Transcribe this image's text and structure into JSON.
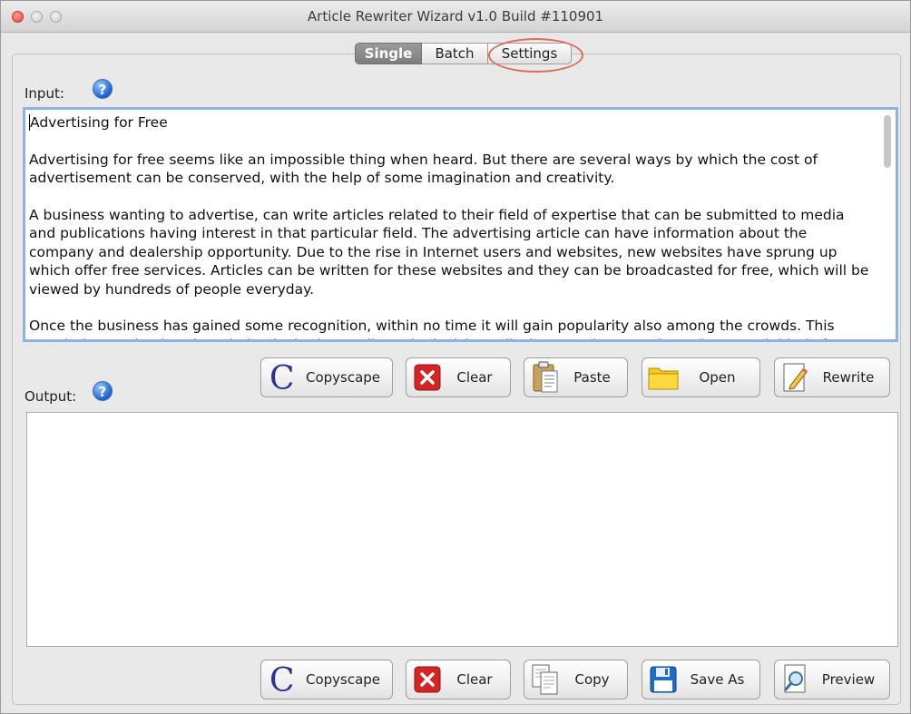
{
  "window": {
    "title": "Article Rewriter Wizard v1.0 Build #110901"
  },
  "tabs": [
    {
      "label": "Single",
      "active": true
    },
    {
      "label": "Batch",
      "active": false
    },
    {
      "label": "Settings",
      "active": false
    }
  ],
  "input": {
    "label": "Input:",
    "help_icon": "question-icon",
    "paragraphs": [
      "Advertising for Free",
      "Advertising for free seems like an impossible thing when heard. But there are several ways by which the cost of advertisement can be conserved, with the help of some imagination and creativity.",
      "A business wanting to advertise, can write articles related to their field of expertise that can be submitted to media and publications having interest in that particular field. The advertising article can have information about the company and dealership opportunity. Due to the rise in Internet users and websites, new websites have sprung up which offer free services. Articles can be written for these websites and they can be broadcasted for free, which will be viewed by hundreds of people everyday.",
      "Once the business has gained some recognition, within no time it will gain popularity also among the crowds. This popularity can lead to them being invited on radio and television talk shows and even to interviews. Such kind of"
    ]
  },
  "input_buttons": [
    {
      "label": "Copyscape",
      "icon": "copyscape-c-icon"
    },
    {
      "label": "Clear",
      "icon": "clear-x-icon"
    },
    {
      "label": "Paste",
      "icon": "clipboard-icon"
    },
    {
      "label": "Open",
      "icon": "folder-icon"
    },
    {
      "label": "Rewrite",
      "icon": "pencil-icon"
    }
  ],
  "output": {
    "label": "Output:",
    "help_icon": "question-icon",
    "value": ""
  },
  "output_buttons": [
    {
      "label": "Copyscape",
      "icon": "copyscape-c-icon"
    },
    {
      "label": "Clear",
      "icon": "clear-x-icon"
    },
    {
      "label": "Copy",
      "icon": "copy-documents-icon"
    },
    {
      "label": "Save As",
      "icon": "floppy-disk-icon"
    },
    {
      "label": "Preview",
      "icon": "magnifier-document-icon"
    }
  ],
  "colors": {
    "clear_red": "#d42424",
    "folder_yellow": "#f6c81c",
    "floppy_blue": "#1b6fc6",
    "focus_ring": "#8db2e3",
    "callout_ring": "#e46a55"
  }
}
